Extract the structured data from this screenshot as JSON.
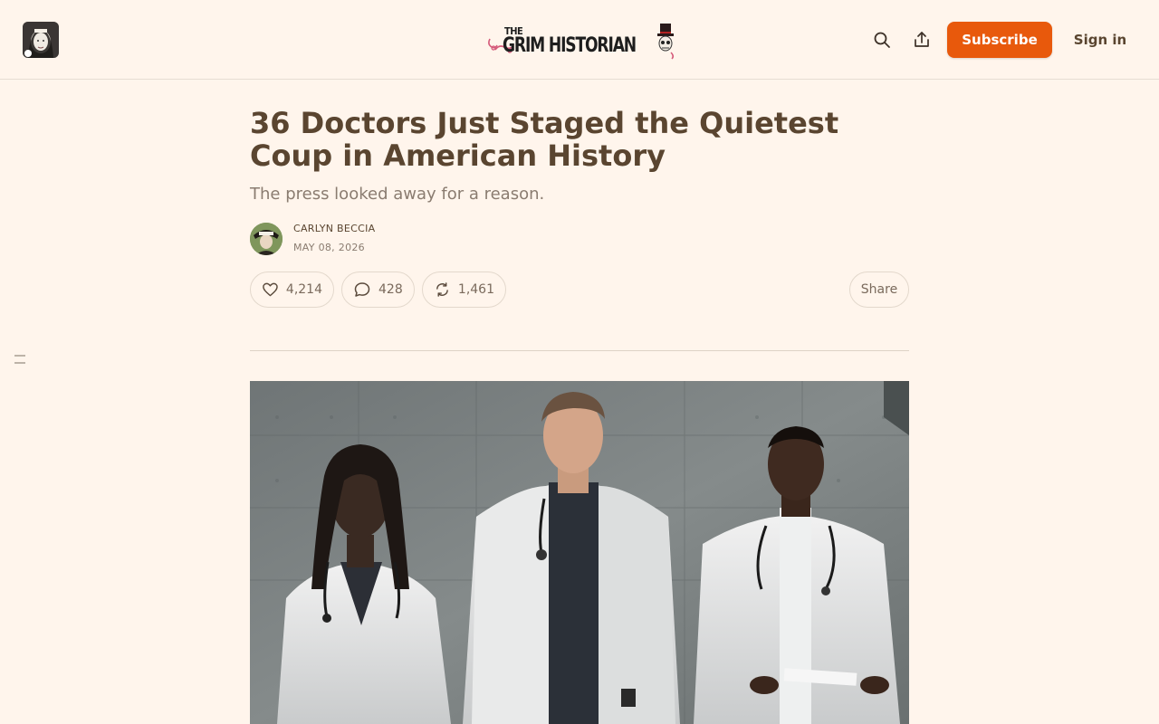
{
  "header": {
    "logo_small": "THE",
    "logo_main": "GRIM HISTORIAN",
    "subscribe_label": "Subscribe",
    "signin_label": "Sign in"
  },
  "article": {
    "title": "36 Doctors Just Staged the Quietest Coup in American History",
    "subtitle": "The press looked away for a reason.",
    "author": "CARLYN BECCIA",
    "date": "MAY 08, 2026"
  },
  "actions": {
    "likes": "4,214",
    "comments": "428",
    "restacks": "1,461",
    "share_label": "Share"
  },
  "colors": {
    "accent": "#e8590c",
    "background": "#fff5ec",
    "text": "#5a4530"
  },
  "icons": [
    "search-icon",
    "share-upload-icon",
    "heart-icon",
    "comment-icon",
    "restack-icon"
  ]
}
